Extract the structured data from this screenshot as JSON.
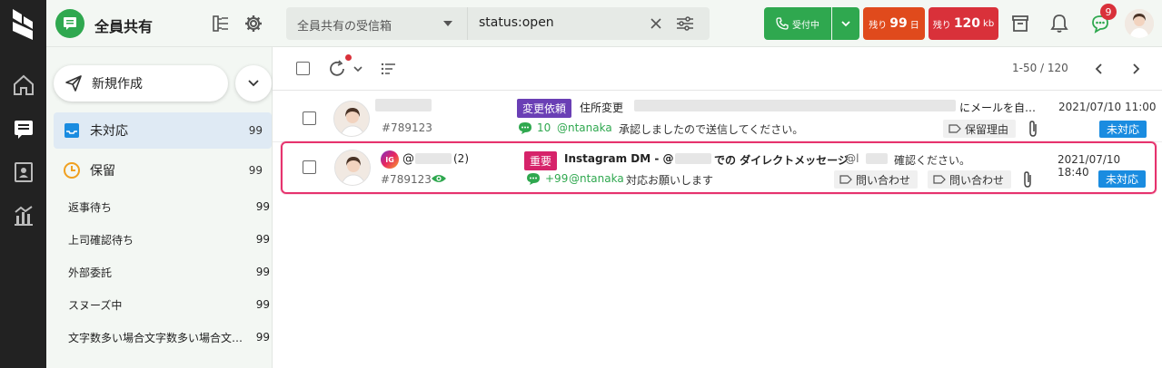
{
  "header": {
    "team_name": "全員共有",
    "inbox_select": "全員共有の受信箱",
    "search_query": "status:open",
    "status_button": "受付中",
    "remaining_days_prefix": "残り",
    "remaining_days_value": "99",
    "remaining_days_unit": "日",
    "remaining_kb_prefix": "残り",
    "remaining_kb_value": "120",
    "remaining_kb_unit": "kb",
    "notification_count": "9"
  },
  "sidebar": {
    "compose_label": "新規作成",
    "folders": [
      {
        "label": "未対応",
        "count": "99"
      },
      {
        "label": "保留",
        "count": "99"
      }
    ],
    "subfolders": [
      {
        "label": "返事待ち",
        "count": "99"
      },
      {
        "label": "上司確認待ち",
        "count": "99"
      },
      {
        "label": "外部委託",
        "count": "99"
      },
      {
        "label": "スヌーズ中",
        "count": "99"
      },
      {
        "label": "文字数多い場合文字数多い場合文字数多い場合",
        "count": "99"
      }
    ]
  },
  "list": {
    "pager": "1-50 / 120",
    "rows": [
      {
        "ticket": "#789123",
        "tag": "変更依頼",
        "subject": "住所変更",
        "subject_tail": "にメールを自…",
        "comment_count": "10",
        "mention": "@ntanaka",
        "comment": "承認しましたので送信してください。",
        "labels": [
          "保留理由"
        ],
        "datetime": "2021/07/10 11:00",
        "status": "未対応"
      },
      {
        "channel_badge": "IG",
        "sender_prefix": "@",
        "sender_count": "(2)",
        "ticket": "#789123",
        "tag": "重要",
        "subject_a": "Instagram DM - @",
        "subject_b": "での ダイレクトメッセージ",
        "preview_prefix": "- @l",
        "preview": "確認ください。",
        "comment_count": "+99",
        "mention": "@ntanaka",
        "comment": "対応お願いします",
        "labels": [
          "問い合わせ",
          "問い合わせ"
        ],
        "datetime": "2021/07/10 18:40",
        "status": "未対応"
      }
    ]
  },
  "colors": {
    "brand_green": "#2fa84f",
    "alert_orange": "#e04a1c",
    "alert_red": "#d9313a",
    "tag_purple": "#6a3fb5",
    "tag_magenta": "#d6236a",
    "status_blue": "#1a8ce0",
    "highlight_pink": "#e6336e"
  }
}
